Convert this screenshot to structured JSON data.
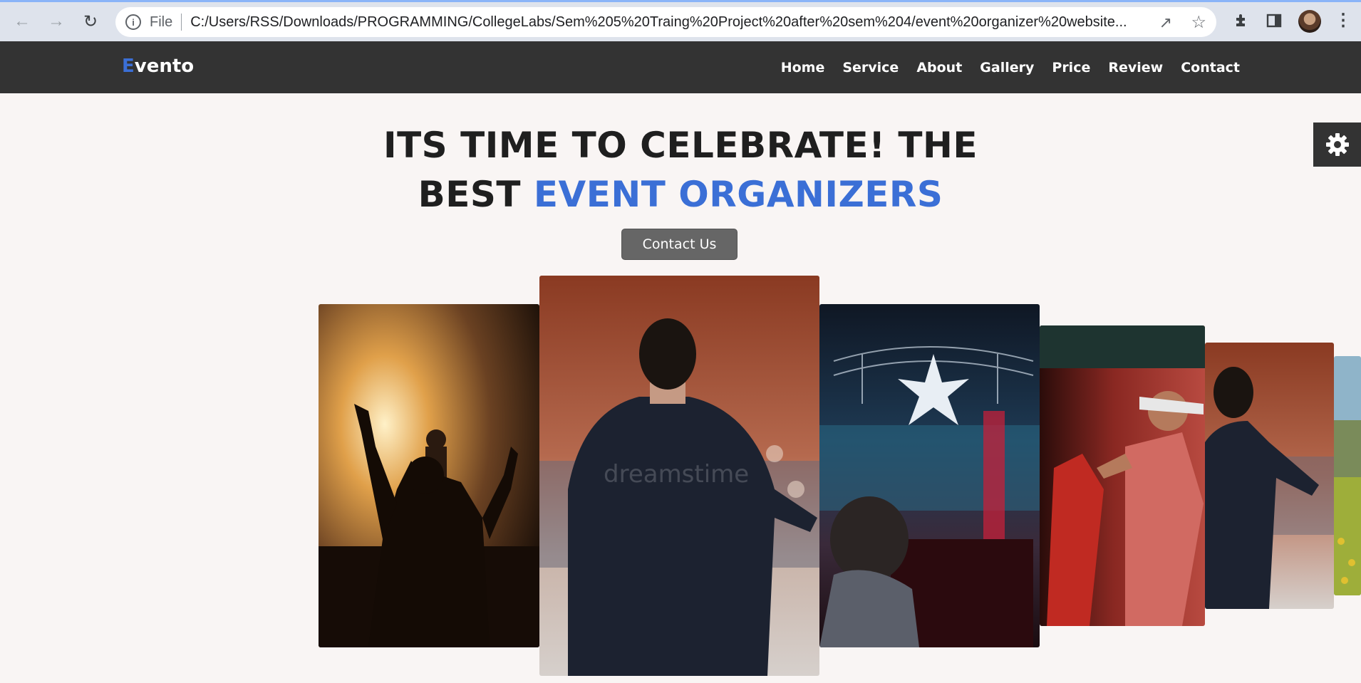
{
  "browser": {
    "file_label": "File",
    "url": "C:/Users/RSS/Downloads/PROGRAMMING/CollegeLabs/Sem%205%20Traing%20Project%20after%20sem%204/event%20organizer%20website..."
  },
  "site": {
    "logo_first": "E",
    "logo_rest": "vento",
    "nav": [
      "Home",
      "Service",
      "About",
      "Gallery",
      "Price",
      "Review",
      "Contact"
    ]
  },
  "hero": {
    "line1": "ITS TIME TO CELEBRATE! THE",
    "line2_plain": "BEST ",
    "line2_accent": "EVENT ORGANIZERS",
    "button": "Contact Us"
  },
  "gallery": {
    "watermark": "dreamstime"
  },
  "colors": {
    "header_bg": "#333333",
    "accent": "#3b6fd6",
    "page_bg": "#f9f5f4",
    "button_bg": "#666666"
  }
}
